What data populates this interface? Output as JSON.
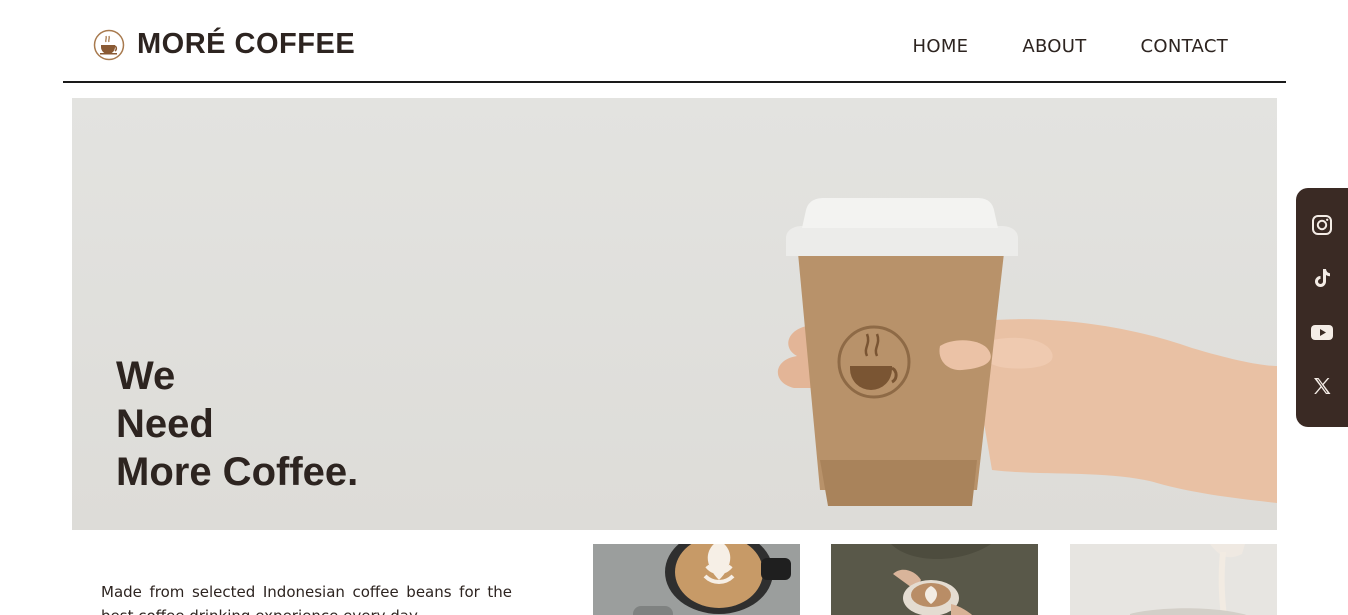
{
  "header": {
    "brand_name": "MORÉ COFFEE",
    "nav": [
      "HOME",
      "ABOUT",
      "CONTACT"
    ]
  },
  "hero": {
    "title_lines": [
      "We",
      "Need",
      "More Coffee."
    ]
  },
  "social": [
    "instagram-icon",
    "tiktok-icon",
    "youtube-icon",
    "x-icon"
  ],
  "about": {
    "text": "Made from selected Indonesian coffee beans for the best coffee drinking experience every day."
  },
  "colors": {
    "brand_brown": "#2d2420",
    "sidebar_bg": "#3a2a24",
    "accent": "#a87a4e"
  }
}
